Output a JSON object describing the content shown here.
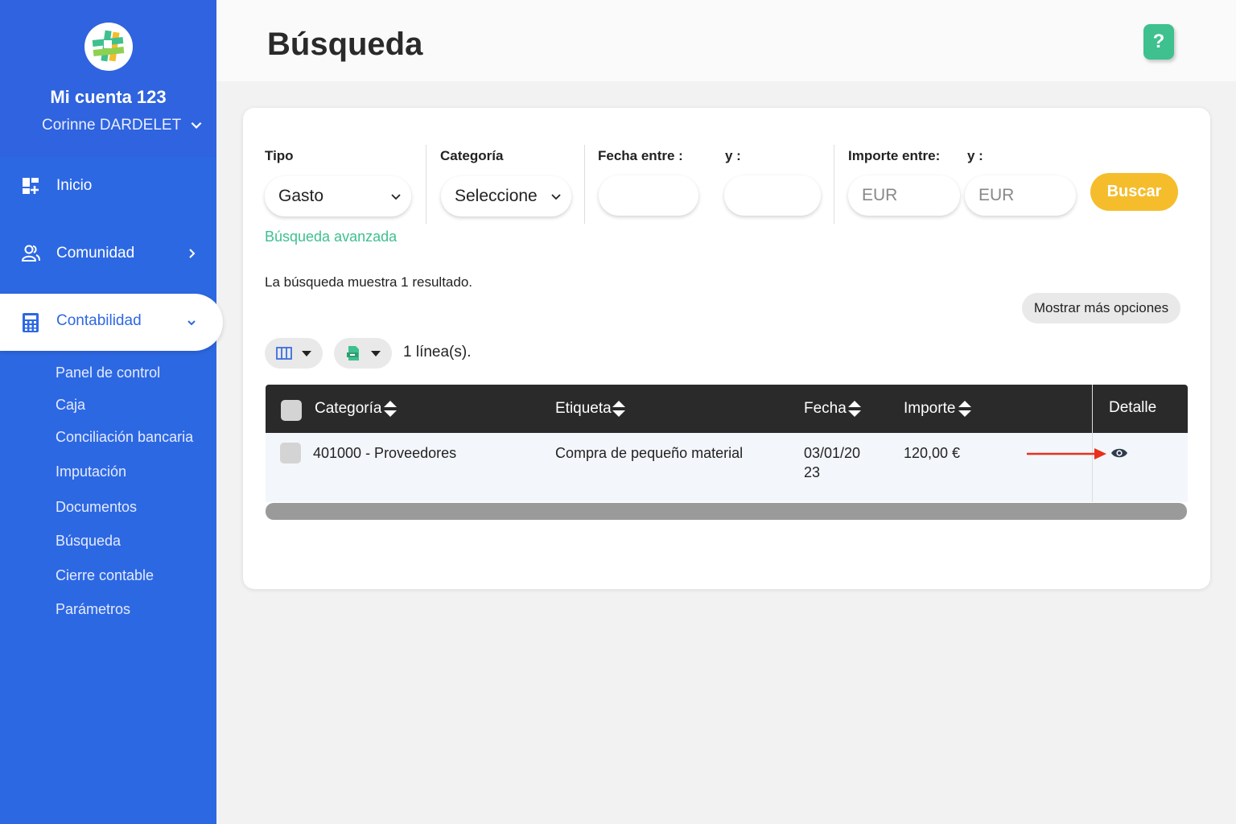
{
  "sidebar": {
    "account_name": "Mi cuenta 123",
    "user_name": "Corinne DARDELET",
    "nav": [
      {
        "label": "Inicio",
        "icon": "dashboard-icon"
      },
      {
        "label": "Comunidad",
        "icon": "users-icon"
      },
      {
        "label": "Contabilidad",
        "icon": "calculator-icon"
      }
    ],
    "sub_items": [
      "Panel de control",
      "Caja",
      "Conciliación bancaria",
      "Imputación",
      "Documentos",
      "Búsqueda",
      "Cierre contable",
      "Parámetros"
    ]
  },
  "header": {
    "title": "Búsqueda",
    "help_label": "?"
  },
  "filters": {
    "tipo_label": "Tipo",
    "tipo_value": "Gasto",
    "categoria_label": "Categoría",
    "categoria_value": "Seleccione",
    "fecha_label": "Fecha entre :",
    "fecha_y_label": "y :",
    "importe_label": "Importe entre:",
    "importe_y_label": "y :",
    "importe_min_placeholder": "EUR",
    "importe_max_placeholder": "EUR",
    "search_button": "Buscar",
    "advanced_link": "Búsqueda avanzada"
  },
  "results": {
    "summary": "La búsqueda muestra 1 resultado.",
    "more_options": "Mostrar más opciones",
    "lines_count": "1 línea(s)."
  },
  "table": {
    "columns": [
      "Categoría",
      "Etiqueta",
      "Fecha",
      "Importe",
      "Detalle"
    ],
    "rows": [
      {
        "categoria": "401000 - Proveedores",
        "etiqueta": "Compra de pequeño material",
        "fecha_line1": "03/01/20",
        "fecha_line2": "23",
        "importe": "120,00 €"
      }
    ]
  },
  "colors": {
    "sidebar": "#2d68e3",
    "accent_green": "#3ec08f",
    "search_yellow": "#f5bd2c",
    "table_header": "#2a2a2a",
    "arrow_red": "#e8301c"
  }
}
